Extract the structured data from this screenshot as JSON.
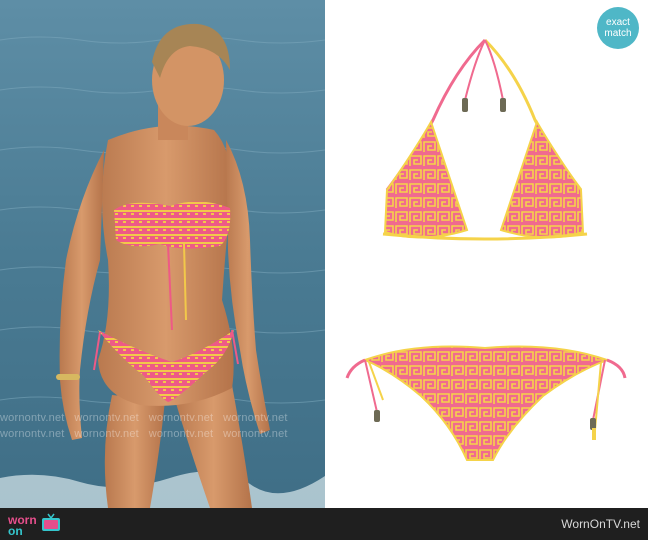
{
  "badge": {
    "line1": "exact",
    "line2": "match"
  },
  "watermark": {
    "text": "wornontv.net"
  },
  "footer": {
    "logo_line1": "worn",
    "logo_line2": "on",
    "credit": "WornOnTV.net"
  },
  "colors": {
    "ocean": "#4d7e96",
    "fabric_pink": "#ee5a86",
    "fabric_yellow": "#f2c84a",
    "badge": "#4fb7c7",
    "footer_bg": "#1f1f1f"
  },
  "icons": [
    "tv-icon",
    "bikini-top-icon",
    "bikini-bottom-icon"
  ]
}
